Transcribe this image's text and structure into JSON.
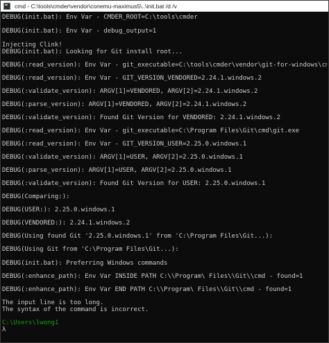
{
  "window": {
    "title": "cmd - C:\\tools\\cmder\\vendor\\conemu-maximus5\\..\\init.bat /d /v"
  },
  "console": {
    "lines": [
      "DEBUG(init.bat): Env Var - CMDER_ROOT=C:\\tools\\cmder",
      "DEBUG(init.bat): Env Var - debug_output=1",
      "Injecting Clink!",
      "DEBUG(init.bat): Looking for Git install root...",
      "DEBUG(:read_version): Env Var - git_executable=C:\\tools\\cmder\\vendor\\git-for-windows\\cmd\\git.exe",
      "DEBUG(:read_version): Env Var - GIT_VERSION_VENDORED=2.24.1.windows.2",
      "DEBUG(:validate_version): ARGV[1]=VENDORED, ARGV[2]=2.24.1.windows.2",
      "DEBUG(:parse_version): ARGV[1]=VENDORED, ARGV[2]=2.24.1.windows.2",
      "DEBUG(:validate_version): Found Git Version for VENDORED: 2.24.1.windows.2",
      "DEBUG(:read_version): Env Var - git_executable=C:\\Program Files\\Git\\cmd\\git.exe",
      "DEBUG(:read_version): Env Var - GIT_VERSION_USER=2.25.0.windows.1",
      "DEBUG(:validate_version): ARGV[1]=USER, ARGV[2]=2.25.0.windows.1",
      "DEBUG(:parse_version): ARGV[1]=USER, ARGV[2]=2.25.0.windows.1",
      "DEBUG(:validate_version): Found Git Version for USER: 2.25.0.windows.1",
      "DEBUG(Comparing:):",
      "DEBUG(USER:): 2.25.0.windows.1",
      "DEBUG(VENDORED:): 2.24.1.windows.2",
      "DEBUG(Using found Git '2.25.0.windows.1' from 'C:\\Program Files\\Git...):",
      "DEBUG(Using Git from 'C:\\Program Files\\Git...):",
      "DEBUG(init.bat): Preferring Windows commands",
      "DEBUG(:enhance_path): Env Var INSIDE PATH C:\\\\Program\\ Files\\\\Git\\\\cmd - found=1",
      "DEBUG(:enhance_path): Env Var END PATH C:\\\\Program\\ Files\\\\Git\\\\cmd - found=1",
      "The input line is too long.",
      "The syntax of the command is incorrect."
    ],
    "prompt_path": "C:\\Users\\lwong1",
    "prompt_symbol": "λ"
  },
  "colors": {
    "background": "#0c0c0c",
    "text": "#cccccc",
    "prompt_path": "#13a10e"
  }
}
